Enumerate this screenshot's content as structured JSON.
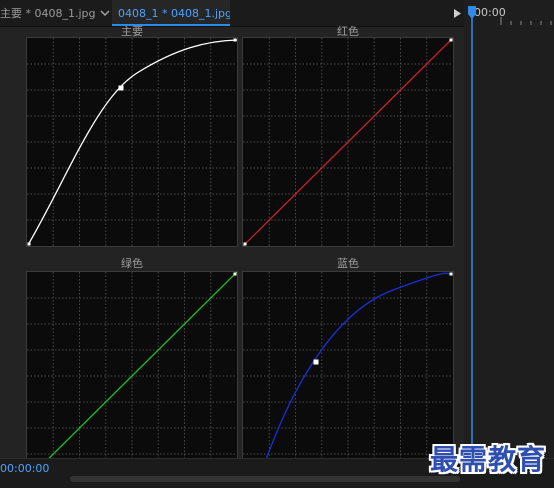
{
  "tabs": [
    {
      "label": "主要 * 0408_1.jpg",
      "active": false
    },
    {
      "label": "0408_1 * 0408_1.jpg",
      "active": true
    }
  ],
  "timeline": {
    "timecode_top": "00:00",
    "timecode_bottom": "00:00:00"
  },
  "curves": [
    {
      "key": "master",
      "label": "主要",
      "color": "#ffffff",
      "shape": "ease-out",
      "control_point": true
    },
    {
      "key": "red",
      "label": "红色",
      "color": "#cc2222",
      "shape": "linear",
      "control_point": false
    },
    {
      "key": "green",
      "label": "绿色",
      "color": "#1fbf1f",
      "shape": "linear",
      "control_point": false
    },
    {
      "key": "blue",
      "label": "蓝色",
      "color": "#1a2fd6",
      "shape": "ease-out",
      "control_point": true
    }
  ],
  "colors": {
    "accent": "#2d8ceb",
    "grid": "#4a4a4a",
    "plot_bg": "#0b0b0b"
  },
  "watermark": "最需教育"
}
